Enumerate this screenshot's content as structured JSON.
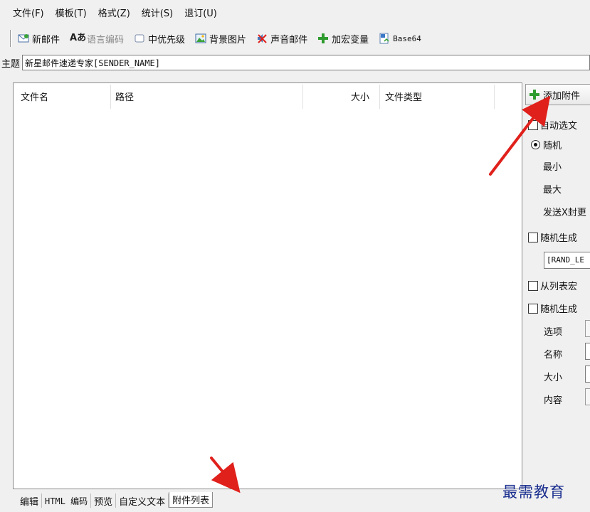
{
  "menu": {
    "items": [
      "文件(F)",
      "模板(T)",
      "格式(Z)",
      "统计(S)",
      "退订(U)"
    ]
  },
  "toolbar": {
    "buttons": [
      {
        "label": "新邮件",
        "icon": "new-mail-icon",
        "enabled": true
      },
      {
        "label": "语言编码",
        "icon": "language-encoding-icon",
        "enabled": false
      },
      {
        "label": "中优先级",
        "icon": "priority-icon",
        "enabled": true
      },
      {
        "label": "背景图片",
        "icon": "background-image-icon",
        "enabled": true
      },
      {
        "label": "声音邮件",
        "icon": "sound-mail-icon",
        "enabled": true
      },
      {
        "label": "加宏变量",
        "icon": "add-macro-icon",
        "enabled": true
      },
      {
        "label": "Base64",
        "icon": "base64-icon",
        "enabled": true
      }
    ]
  },
  "subject": {
    "label": "主题",
    "value": "新星邮件速递专家[SENDER_NAME]"
  },
  "file_list": {
    "columns": [
      "文件名",
      "路径",
      "大小",
      "文件类型"
    ],
    "rows": []
  },
  "attachment_panel": {
    "add_button": "添加附件",
    "auto_select": "自动选文",
    "random_option": "随机",
    "min_label": "最小",
    "max_label": "最大",
    "send_cover": "发送X封更",
    "random_gen_1": "随机生成",
    "rand_field_value": "[RAND_LE",
    "from_list_macro": "从列表宏",
    "random_gen_2": "随机生成",
    "options_label": "选项",
    "name_label": "名称",
    "size_label": "大小",
    "content_label": "内容"
  },
  "bottom_tabs": [
    "编辑",
    "HTML 编码",
    "预览",
    "自定义文本",
    "附件列表"
  ],
  "active_tab": "附件列表",
  "watermark": "最需教育",
  "colors": {
    "accent_green": "#2e9b2e",
    "arrow_red": "#e0201b",
    "watermark_blue": "#1b2f8f"
  }
}
